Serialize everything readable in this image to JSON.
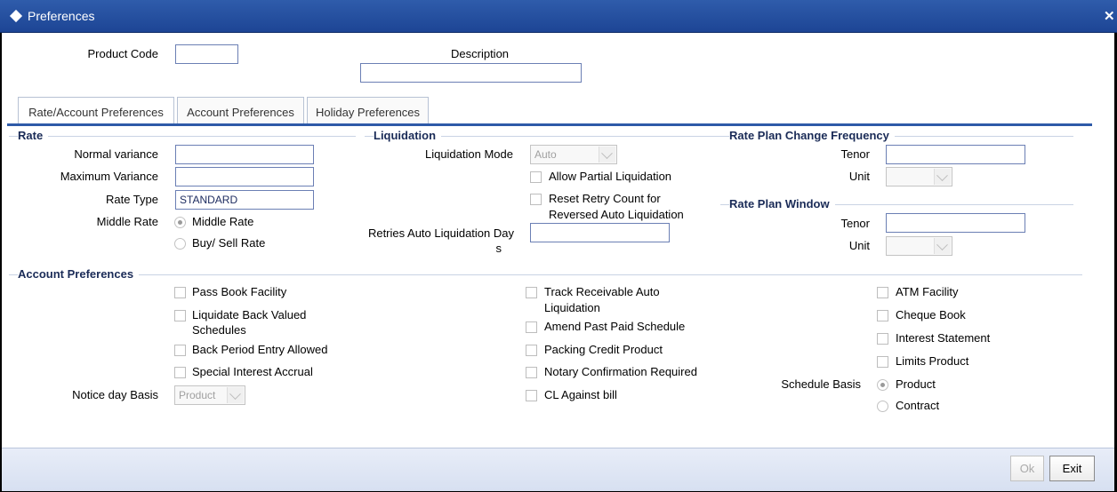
{
  "window": {
    "title": "Preferences",
    "close_glyph": "✕"
  },
  "header": {
    "product_code_label": "Product Code",
    "product_code_value": "",
    "description_label": "Description",
    "description_value": ""
  },
  "tabs": [
    {
      "label": "Rate/Account Preferences"
    },
    {
      "label": "Account Preferences"
    },
    {
      "label": "Holiday Preferences"
    }
  ],
  "rate": {
    "section": "Rate",
    "normal_variance_label": "Normal variance",
    "maximum_variance_label": "Maximum Variance",
    "rate_type_label": "Rate Type",
    "rate_type_value": "STANDARD",
    "middle_rate_label": "Middle Rate",
    "middle_rate_option": "Middle Rate",
    "buy_sell_option": "Buy/ Sell Rate"
  },
  "liquidation": {
    "section": "Liquidation",
    "mode_label": "Liquidation Mode",
    "mode_value": "Auto",
    "allow_partial": "Allow Partial Liquidation",
    "reset_retry_line1": "Reset Retry Count for",
    "reset_retry_line2": "Reversed Auto Liquidation",
    "retries_line1": "Retries Auto Liquidation Day",
    "retries_line2": "s"
  },
  "rate_plan_change": {
    "section": "Rate Plan Change Frequency",
    "tenor_label": "Tenor",
    "unit_label": "Unit"
  },
  "rate_plan_window": {
    "section": "Rate Plan Window",
    "tenor_label": "Tenor",
    "unit_label": "Unit"
  },
  "account_prefs": {
    "section": "Account Preferences",
    "col1": {
      "pass_book": "Pass Book Facility",
      "liquidate_back_line1": "Liquidate Back Valued",
      "liquidate_back_line2": "Schedules",
      "back_period": "Back Period Entry Allowed",
      "special_interest": "Special Interest Accrual",
      "notice_day_label": "Notice day Basis",
      "notice_day_value": "Product"
    },
    "col2": {
      "track_receivable_line1": "Track Receivable Auto",
      "track_receivable_line2": "Liquidation",
      "amend_past": "Amend Past Paid Schedule",
      "packing_credit": "Packing Credit Product",
      "notary": "Notary Confirmation Required",
      "cl_against": "CL Against bill"
    },
    "col3": {
      "atm": "ATM Facility",
      "cheque": "Cheque Book",
      "interest_statement": "Interest Statement",
      "limits": "Limits Product",
      "schedule_basis_label": "Schedule Basis",
      "product_option": "Product",
      "contract_option": "Contract"
    }
  },
  "footer": {
    "ok_label": "Ok",
    "exit_label": "Exit"
  }
}
